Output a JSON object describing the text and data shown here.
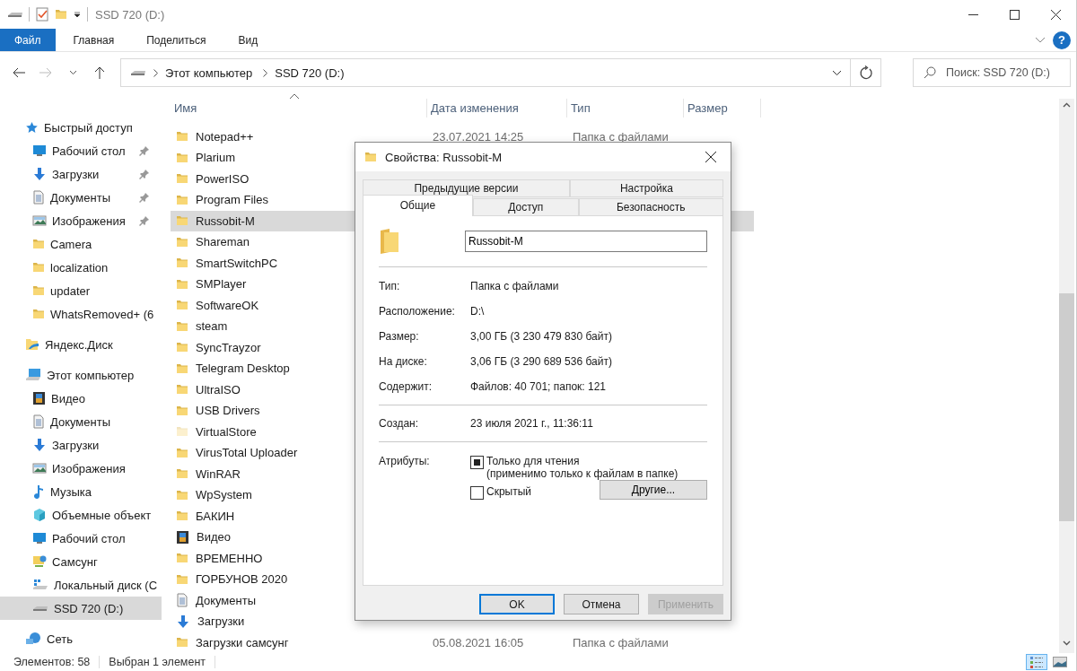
{
  "window": {
    "title": "SSD 720 (D:)"
  },
  "ribbon": {
    "tabs": [
      {
        "label": "Файл",
        "kind": "file"
      },
      {
        "label": "Главная",
        "kind": "tab"
      },
      {
        "label": "Поделиться",
        "kind": "tab"
      },
      {
        "label": "Вид",
        "kind": "tab"
      }
    ],
    "help": "?"
  },
  "navigation": {
    "back": {
      "disabled": false
    },
    "forward": {
      "disabled": true
    }
  },
  "address_bar": {
    "segments": [
      "Этот компьютер",
      "SSD 720 (D:)"
    ]
  },
  "search": {
    "placeholder": "Поиск: SSD 720 (D:)"
  },
  "sidebar": {
    "items": [
      {
        "label": "Быстрый доступ",
        "kind": "star",
        "selected": false,
        "children": [
          {
            "label": "Рабочий стол",
            "kind": "desktop",
            "pinned": true,
            "selected": false
          },
          {
            "label": "Загрузки",
            "kind": "download",
            "pinned": true,
            "selected": false
          },
          {
            "label": "Документы",
            "kind": "document",
            "pinned": true,
            "selected": false
          },
          {
            "label": "Изображения",
            "kind": "images",
            "pinned": true,
            "selected": false
          },
          {
            "label": "Camera",
            "kind": "folder",
            "pinned": false,
            "selected": false
          },
          {
            "label": "localization",
            "kind": "folder",
            "pinned": false,
            "selected": false
          },
          {
            "label": "updater",
            "kind": "folder",
            "pinned": false,
            "selected": false
          },
          {
            "label": "WhatsRemoved+ (6",
            "kind": "folder",
            "pinned": false,
            "selected": false
          }
        ]
      },
      {
        "label": "Яндекс.Диск",
        "kind": "cloud",
        "selected": false
      },
      {
        "label": "Этот компьютер",
        "kind": "computer",
        "selected": false,
        "children": [
          {
            "label": "Видео",
            "kind": "video",
            "pinned": false,
            "selected": false
          },
          {
            "label": "Документы",
            "kind": "document",
            "pinned": false,
            "selected": false
          },
          {
            "label": "Загрузки",
            "kind": "download",
            "pinned": false,
            "selected": false
          },
          {
            "label": "Изображения",
            "kind": "images",
            "pinned": false,
            "selected": false
          },
          {
            "label": "Музыка",
            "kind": "music",
            "pinned": false,
            "selected": false
          },
          {
            "label": "Объемные объект",
            "kind": "cube",
            "pinned": false,
            "selected": false
          },
          {
            "label": "Рабочий стол",
            "kind": "desktop",
            "pinned": false,
            "selected": false
          },
          {
            "label": "Самсунг",
            "kind": "phone",
            "pinned": false,
            "selected": false
          },
          {
            "label": "Локальный диск (С",
            "kind": "localdisk",
            "pinned": false,
            "selected": false
          },
          {
            "label": "SSD 720 (D:)",
            "kind": "drive",
            "pinned": false,
            "selected": true
          }
        ]
      },
      {
        "label": "Сеть",
        "kind": "network",
        "selected": false
      }
    ]
  },
  "file_list": {
    "columns": [
      "Имя",
      "Дата изменения",
      "Тип",
      "Размер"
    ],
    "rows": [
      {
        "name": "Notepad++",
        "kind": "folder",
        "selected": false,
        "date": "23.07.2021 14:25",
        "type": "Папка с файлами"
      },
      {
        "name": "Plarium",
        "kind": "folder",
        "selected": false
      },
      {
        "name": "PowerISO",
        "kind": "folder",
        "selected": false
      },
      {
        "name": "Program Files",
        "kind": "folder",
        "selected": false
      },
      {
        "name": "Russobit-M",
        "kind": "folder",
        "selected": true
      },
      {
        "name": "Shareman",
        "kind": "folder",
        "selected": false
      },
      {
        "name": "SmartSwitchPC",
        "kind": "folder",
        "selected": false
      },
      {
        "name": "SMPlayer",
        "kind": "folder",
        "selected": false
      },
      {
        "name": "SoftwareOK",
        "kind": "folder",
        "selected": false
      },
      {
        "name": "steam",
        "kind": "folder",
        "selected": false
      },
      {
        "name": "SyncTrayzor",
        "kind": "folder",
        "selected": false
      },
      {
        "name": "Telegram Desktop",
        "kind": "folder",
        "selected": false
      },
      {
        "name": "UltraISO",
        "kind": "folder",
        "selected": false
      },
      {
        "name": "USB Drivers",
        "kind": "folder",
        "selected": false
      },
      {
        "name": "VirtualStore",
        "kind": "folder-hidden",
        "selected": false
      },
      {
        "name": "VirusTotal Uploader",
        "kind": "folder",
        "selected": false
      },
      {
        "name": "WinRAR",
        "kind": "folder",
        "selected": false
      },
      {
        "name": "WpSystem",
        "kind": "folder",
        "selected": false
      },
      {
        "name": "БАКИН",
        "kind": "folder",
        "selected": false
      },
      {
        "name": "Видео",
        "kind": "video",
        "selected": false
      },
      {
        "name": "ВРЕМЕННО",
        "kind": "folder",
        "selected": false
      },
      {
        "name": "ГОРБУНОВ 2020",
        "kind": "folder",
        "selected": false
      },
      {
        "name": "Документы",
        "kind": "document",
        "selected": false
      },
      {
        "name": "Загрузки",
        "kind": "download",
        "selected": false
      },
      {
        "name": "Загрузки самсунг",
        "kind": "folder",
        "selected": false,
        "date": "05.08.2021 16:05",
        "type": "Папка с файлами"
      }
    ]
  },
  "status_bar": {
    "items": [
      "Элементов: 58",
      "Выбран 1 элемент"
    ],
    "views": [
      {
        "kind": "details",
        "selected": true
      },
      {
        "kind": "tiles",
        "selected": false
      }
    ]
  },
  "dialog": {
    "title": "Свойства: Russobit-M",
    "tab_rows": [
      {
        "tabs": [
          {
            "label": "Предыдущие версии",
            "selected": false
          },
          {
            "label": "Настройка",
            "selected": false
          }
        ]
      },
      {
        "tabs": [
          {
            "label": "Общие",
            "selected": true
          },
          {
            "label": "Доступ",
            "selected": false
          },
          {
            "label": "Безопасность",
            "selected": false
          }
        ]
      }
    ],
    "name": "Russobit-M",
    "groups": [
      [
        {
          "label": "Тип:",
          "value": "Папка с файлами"
        },
        {
          "label": "Расположение:",
          "value": "D:\\"
        },
        {
          "label": "Размер:",
          "value": "3,00 ГБ (3 230 479 830 байт)"
        },
        {
          "label": "На диске:",
          "value": "3,06 ГБ (3 290 689 536 байт)"
        },
        {
          "label": "Содержит:",
          "value": "Файлов: 40 701; папок: 121"
        }
      ],
      [
        {
          "label": "Создан:",
          "value": "23 июля 2021 г., 11:36:11"
        }
      ]
    ],
    "attributes": {
      "label": "Атрибуты:",
      "readonly": {
        "label": "Только для чтения",
        "note": "(применимо только к файлам в папке)",
        "checked": false,
        "indeterminate": true
      },
      "hidden": {
        "label": "Скрытый",
        "checked": false,
        "indeterminate": false
      },
      "advanced": "Другие..."
    },
    "buttons": [
      {
        "label": "OK",
        "default": true,
        "disabled": false
      },
      {
        "label": "Отмена",
        "default": false,
        "disabled": false
      },
      {
        "label": "Применить",
        "default": false,
        "disabled": true
      }
    ]
  }
}
